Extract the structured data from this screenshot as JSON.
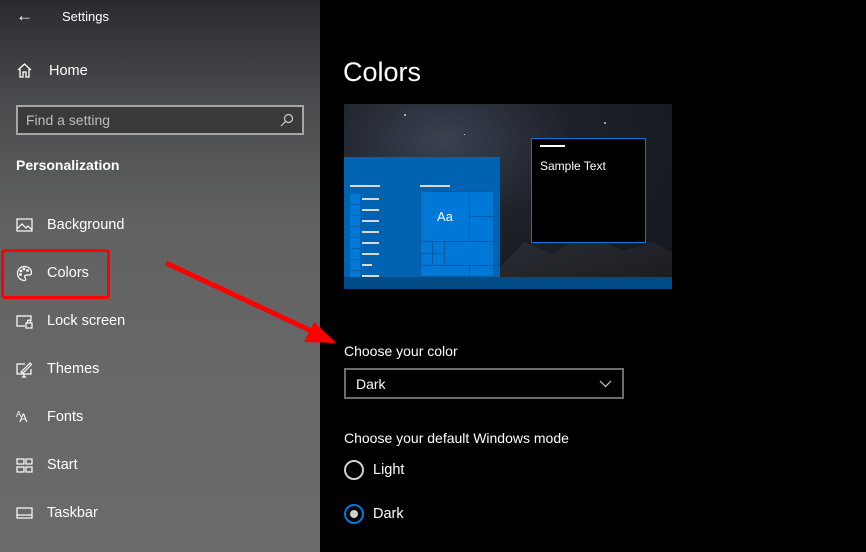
{
  "window": {
    "title": "Settings",
    "back_icon": "arrow-left-icon"
  },
  "sidebar": {
    "home": "Home",
    "search_placeholder": "Find a setting",
    "section": "Personalization",
    "items": [
      {
        "label": "Background",
        "icon": "image-icon"
      },
      {
        "label": "Colors",
        "icon": "palette-icon",
        "selected": true
      },
      {
        "label": "Lock screen",
        "icon": "lock-screen-icon"
      },
      {
        "label": "Themes",
        "icon": "themes-icon"
      },
      {
        "label": "Fonts",
        "icon": "fonts-icon"
      },
      {
        "label": "Start",
        "icon": "start-icon"
      },
      {
        "label": "Taskbar",
        "icon": "taskbar-icon"
      }
    ]
  },
  "main": {
    "title": "Colors",
    "preview": {
      "sample_text": "Sample Text",
      "tile_text": "Aa"
    },
    "choose_color": {
      "label": "Choose your color",
      "value": "Dark"
    },
    "windows_mode": {
      "label": "Choose your default Windows mode",
      "options": [
        {
          "label": "Light",
          "selected": false
        },
        {
          "label": "Dark",
          "selected": true
        }
      ]
    }
  },
  "colors": {
    "accent": "#0078d7",
    "annotation": "#ff0000",
    "sidebar": "#686868",
    "background": "#000000"
  }
}
